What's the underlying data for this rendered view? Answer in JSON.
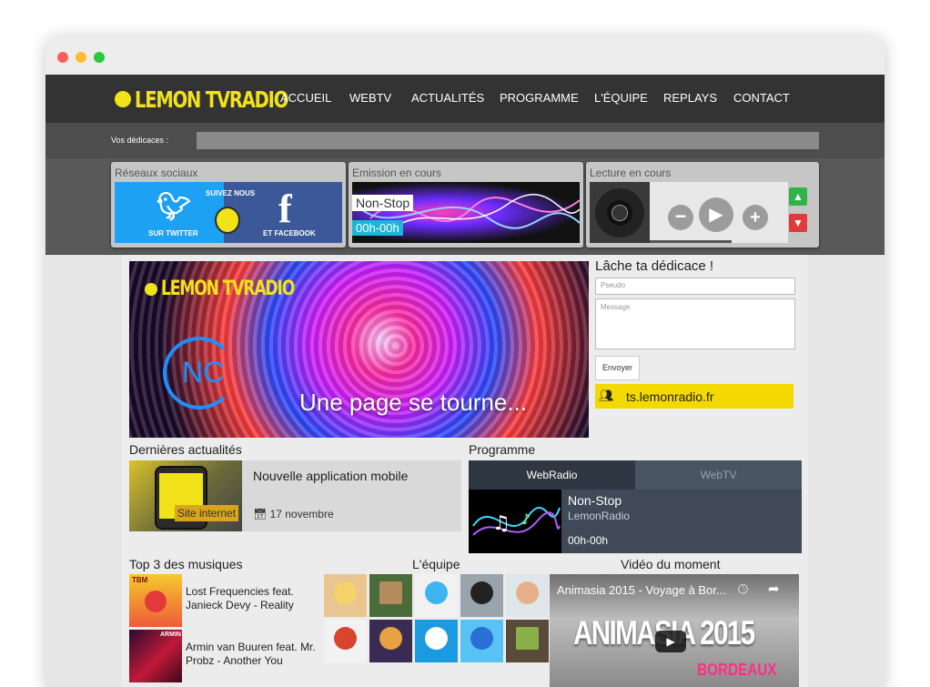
{
  "nav": {
    "logo_text": "LEMON TVRADIO",
    "items": [
      "ACCUEIL",
      "WEBTV",
      "ACTUALITÉS",
      "PROGRAMME",
      "L'ÉQUIPE",
      "REPLAYS",
      "CONTACT"
    ]
  },
  "dedicaces_bar": {
    "label": "Vos dédicaces :"
  },
  "widgets": {
    "social": {
      "title": "Réseaux sociaux",
      "suivez": "SUIVEZ NOUS",
      "twitter": "SUR TWITTER",
      "facebook": "ET FACEBOOK"
    },
    "emission": {
      "title": "Emission en cours",
      "name": "Non-Stop",
      "time": "00h-00h"
    },
    "lecture": {
      "title": "Lecture en cours",
      "minus": "−",
      "play": "▶",
      "plus": "+"
    }
  },
  "banner": {
    "logo_text": "LEMON TVRADIO",
    "nc": "NC",
    "caption": "Une page se tourne..."
  },
  "dedicace_form": {
    "title": "Lâche ta dédicace !",
    "pseudo_placeholder": "Pseudo",
    "message_placeholder": "Message",
    "submit": "Envoyer",
    "ts": "ts.lemonradio.fr"
  },
  "news": {
    "section_title": "Dernières actualités",
    "tag": "Site internet",
    "title": "Nouvelle application mobile",
    "date": "17 novembre"
  },
  "programme": {
    "section_title": "Programme",
    "tabs": [
      "WebRadio",
      "WebTV"
    ],
    "title": "Non-Stop",
    "subtitle": "LemonRadio",
    "time": "00h-00h"
  },
  "top3": {
    "section_title": "Top 3 des musiques",
    "items": [
      {
        "text": "Lost Frequencies feat. Janieck Devy - Reality",
        "cover_label": "TBM"
      },
      {
        "text": "Armin van Buuren feat. Mr. Probz - Another You",
        "cover_label": "ARMIN"
      }
    ]
  },
  "team": {
    "section_title": "L'équipe"
  },
  "video": {
    "section_title": "Vidéo du moment",
    "title": "Animasia 2015 - Voyage à Bor...",
    "big": "ANIMASIA 2015",
    "city": "BORDEAUX"
  },
  "colors": {
    "lemon": "#f1e21a",
    "nav_bg": "#333333",
    "ts_yellow": "#f4d900",
    "prog_dark": "#2f3742",
    "twitter": "#1da1f2",
    "facebook": "#3b5998"
  }
}
